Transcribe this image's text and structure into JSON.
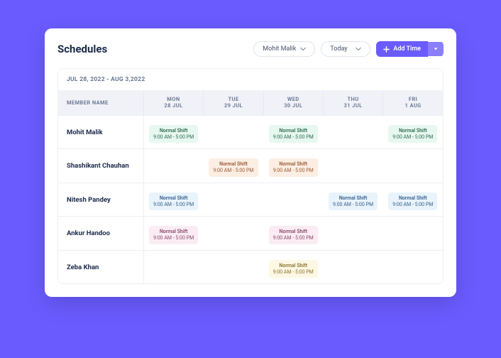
{
  "header": {
    "title": "Schedules",
    "memberSelect": "Mohit Malik",
    "dateSelect": "Today",
    "addButton": "Add Time"
  },
  "range": "JUL 28, 2022 - AUG 3,2022",
  "columns": {
    "name": "MEMBER NAME",
    "days": [
      {
        "dow": "MON",
        "label": "28 JUL"
      },
      {
        "dow": "TUE",
        "label": "29 JUL"
      },
      {
        "dow": "WED",
        "label": "30 JUL"
      },
      {
        "dow": "THU",
        "label": "31 JUL"
      },
      {
        "dow": "FRI",
        "label": "1 AUG"
      }
    ]
  },
  "shift": {
    "name": "Normal Shift",
    "time": "9:00 AM - 5:00 PM"
  },
  "rows": [
    {
      "member": "Mohit Malik",
      "color": "c-green",
      "cells": [
        true,
        false,
        true,
        false,
        true
      ]
    },
    {
      "member": "Shashikant Chauhan",
      "color": "c-orange",
      "cells": [
        false,
        true,
        true,
        false,
        false
      ]
    },
    {
      "member": "Nitesh Pandey",
      "color": "c-blue",
      "cells": [
        true,
        false,
        false,
        true,
        true
      ]
    },
    {
      "member": "Ankur Handoo",
      "color": "c-pink",
      "cells": [
        true,
        false,
        true,
        false,
        false
      ]
    },
    {
      "member": "Zeba Khan",
      "color": "c-yellow",
      "cells": [
        false,
        false,
        true,
        false,
        false
      ]
    }
  ]
}
